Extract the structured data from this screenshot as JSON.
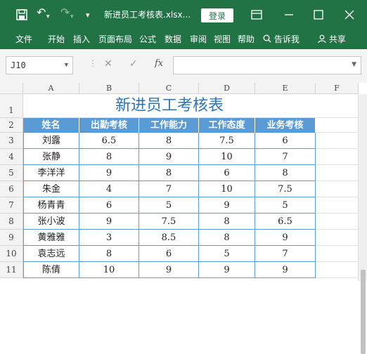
{
  "titlebar": {
    "filename": "新进员工考核表.xlsx...",
    "login_label": "登录",
    "undo_label": "↶",
    "redo_label": "↷",
    "customize_label": "▾"
  },
  "ribbon": {
    "tabs": [
      "文件",
      "开始",
      "插入",
      "页面布局",
      "公式",
      "数据",
      "审阅",
      "视图",
      "帮助"
    ],
    "tell_me": "告诉我",
    "share": "共享"
  },
  "formula_bar": {
    "name_box": "J10",
    "cancel_glyph": "✕",
    "enter_glyph": "✓",
    "fx_label": "fx",
    "formula_value": ""
  },
  "sheet": {
    "col_letters": [
      "A",
      "B",
      "C",
      "D",
      "E",
      "F"
    ],
    "row_numbers": [
      "1",
      "2",
      "3",
      "4",
      "5",
      "6",
      "7",
      "8",
      "9",
      "10",
      "11"
    ],
    "title": "新进员工考核表",
    "headers": [
      "姓名",
      "出勤考核",
      "工作能力",
      "工作态度",
      "业务考核"
    ],
    "rows": [
      [
        "刘露",
        "6.5",
        "8",
        "7.5",
        "6"
      ],
      [
        "张静",
        "8",
        "9",
        "10",
        "7"
      ],
      [
        "李洋洋",
        "9",
        "8",
        "6",
        "8"
      ],
      [
        "朱金",
        "4",
        "7",
        "10",
        "7.5"
      ],
      [
        "杨青青",
        "6",
        "5",
        "9",
        "5"
      ],
      [
        "张小波",
        "9",
        "7.5",
        "8",
        "6.5"
      ],
      [
        "黄雅雅",
        "3",
        "8.5",
        "8",
        "9"
      ],
      [
        "袁志远",
        "8",
        "6",
        "5",
        "7"
      ],
      [
        "陈倩",
        "10",
        "9",
        "9",
        "9"
      ]
    ]
  },
  "colors": {
    "excel_green": "#217346",
    "header_blue": "#5b9bd5",
    "title_blue": "#2e75b6"
  }
}
